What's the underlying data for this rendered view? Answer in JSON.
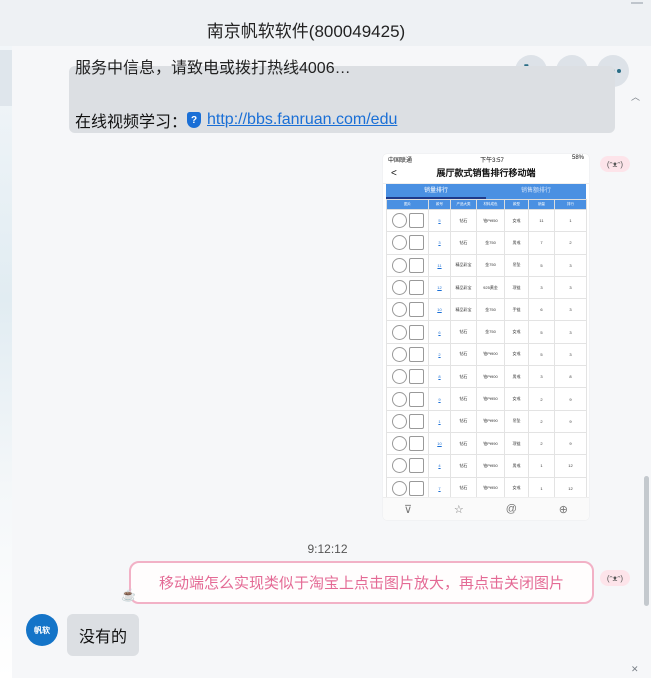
{
  "window": {
    "title": "南京帆软软件(800049425)"
  },
  "toolbar": {
    "phone_icon": "phone-icon",
    "video_icon": "video-icon",
    "more_icon": "more-icon"
  },
  "messages": {
    "m1": {
      "clipped_text": "服务中信息，请致电或拨打热线4006…",
      "label": "在线视频学习：",
      "link": "http://bbs.fanruan.com/edu"
    },
    "screenshot": {
      "status": {
        "carrier": "中国联通",
        "time": "下午3:57",
        "battery": "58%"
      },
      "title": "展厅款式销售排行移动端",
      "tabs": [
        "销量排行",
        "销售额排行"
      ],
      "headers": [
        "图片",
        "款号",
        "产品大类",
        "材料成色",
        "款型",
        "销量",
        "排行"
      ],
      "rows": [
        [
          "",
          "5",
          "钻石",
          "铂Pt950",
          "女戒",
          "11",
          "1"
        ],
        [
          "",
          "3",
          "钻石",
          "金750",
          "男戒",
          "7",
          "2"
        ],
        [
          "",
          "11",
          "精品彩宝",
          "金750",
          "吊坠",
          "5",
          "3"
        ],
        [
          "",
          "12",
          "精品彩宝",
          "925黄金",
          "项链",
          "3",
          "3"
        ],
        [
          "",
          "10",
          "精品彩宝",
          "金750",
          "手链",
          "6",
          "3"
        ],
        [
          "",
          "6",
          "钻石",
          "金750",
          "女戒",
          "5",
          "3"
        ],
        [
          "",
          "2",
          "钻石",
          "铂Pt900",
          "女戒",
          "5",
          "3"
        ],
        [
          "",
          "8",
          "钻石",
          "铂Pt900",
          "男戒",
          "3",
          "8"
        ],
        [
          "",
          "9",
          "钻石",
          "铂Pt950",
          "女戒",
          "2",
          "9"
        ],
        [
          "",
          "1",
          "钻石",
          "铂Pt990",
          "吊坠",
          "2",
          "9"
        ],
        [
          "",
          "10",
          "钻石",
          "铂Pt990",
          "项链",
          "2",
          "9"
        ],
        [
          "",
          "4",
          "钻石",
          "铂Pt950",
          "男戒",
          "1",
          "12"
        ],
        [
          "",
          "7",
          "钻石",
          "铂Pt950",
          "女戒",
          "1",
          "12"
        ]
      ]
    },
    "timestamp": "9:12:12",
    "m2": "移动端怎么实现类似于淘宝上点击图片放大，再点击关闭图片",
    "bot_avatar": "帆软",
    "m3": "没有的"
  },
  "colors": {
    "accent": "#1a6fd6",
    "pink": "#e46a95",
    "table_header": "#4a90e2"
  }
}
